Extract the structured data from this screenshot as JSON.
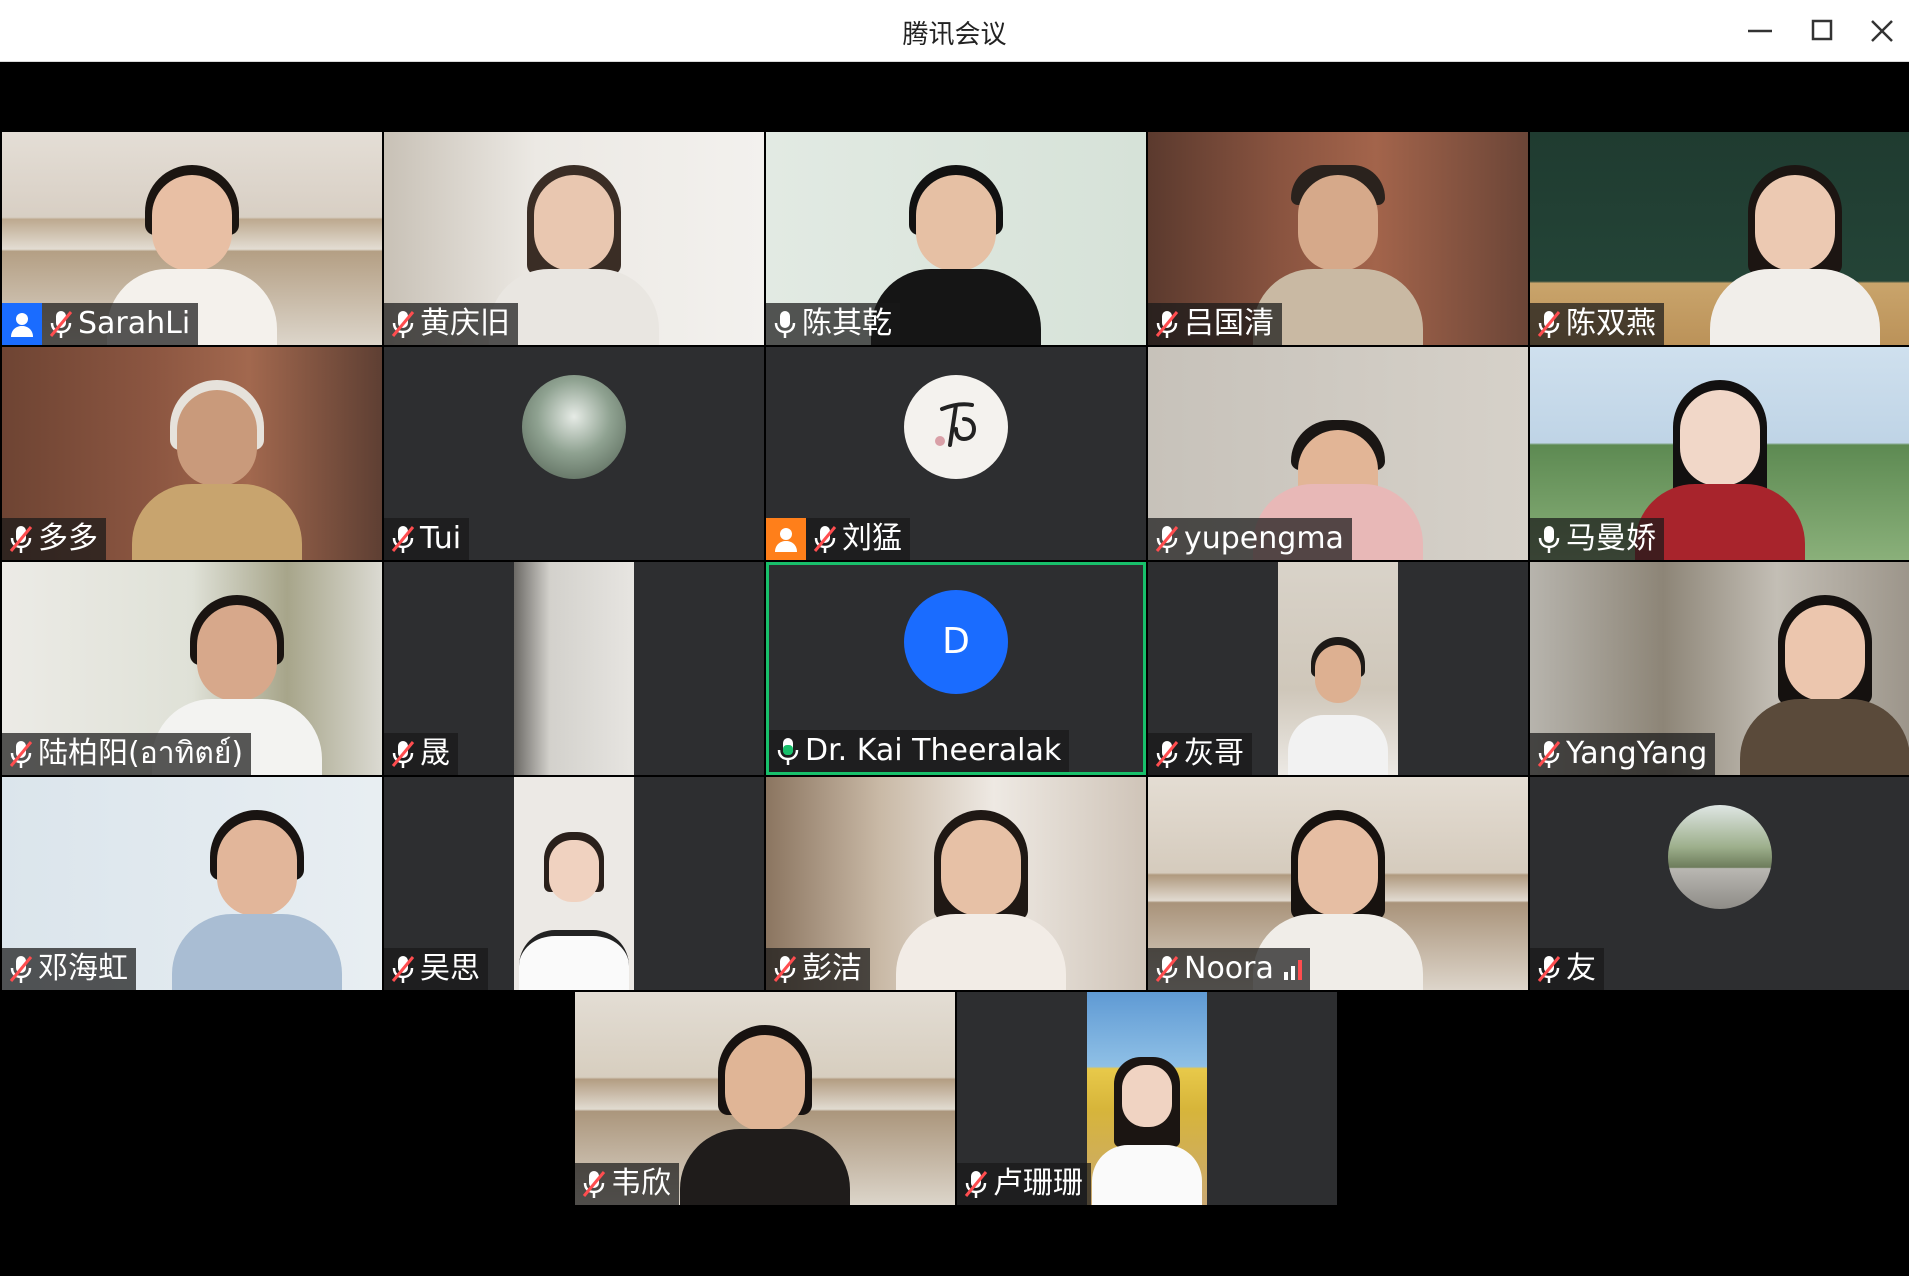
{
  "window": {
    "title": "腾讯会议",
    "controls": [
      "minimize-icon",
      "maximize-icon",
      "close-icon"
    ]
  },
  "colors": {
    "tile_bg": "#2d2e30",
    "label_bg": "rgba(25,25,25,0.72)",
    "active_speaker_border": "#18c06b",
    "host_badge": "#1a6cff",
    "cohost_badge": "#ff7f1a",
    "muted_icon": "#ff4d4f",
    "letter_avatar": "#1a6cff"
  },
  "participants": [
    {
      "name": "SarahLi",
      "mic": "muted",
      "badge": "host-icon"
    },
    {
      "name": "黄庆旧",
      "mic": "muted"
    },
    {
      "name": "陈其乾",
      "mic": "on"
    },
    {
      "name": "吕国清",
      "mic": "muted"
    },
    {
      "name": "陈双燕",
      "mic": "muted"
    },
    {
      "name": "多多",
      "mic": "muted"
    },
    {
      "name": "Tui",
      "mic": "muted",
      "video": "off",
      "avatar": "waterfall-avatar"
    },
    {
      "name": "刘猛",
      "mic": "muted",
      "video": "off",
      "avatar": "calligraphy-avatar",
      "badge": "cohost-icon"
    },
    {
      "name": "yupengma",
      "mic": "muted"
    },
    {
      "name": "马曼娇",
      "mic": "on"
    },
    {
      "name": "陆柏阳(อาทิตย์)",
      "mic": "muted"
    },
    {
      "name": "晟",
      "mic": "muted"
    },
    {
      "name": "Dr. Kai Theeralak",
      "mic": "speaking",
      "video": "off",
      "avatar_letter": "D",
      "active_speaker": true
    },
    {
      "name": "灰哥",
      "mic": "muted"
    },
    {
      "name": "YangYang",
      "mic": "muted"
    },
    {
      "name": "邓海虹",
      "mic": "muted"
    },
    {
      "name": "吴思",
      "mic": "muted"
    },
    {
      "name": "彭洁",
      "mic": "muted"
    },
    {
      "name": "Noora",
      "mic": "muted",
      "network": "signal-bars-icon"
    },
    {
      "name": "友",
      "mic": "muted",
      "video": "off",
      "avatar": "road-avatar"
    },
    {
      "name": "韦欣",
      "mic": "muted"
    },
    {
      "name": "卢珊珊",
      "mic": "muted"
    }
  ]
}
